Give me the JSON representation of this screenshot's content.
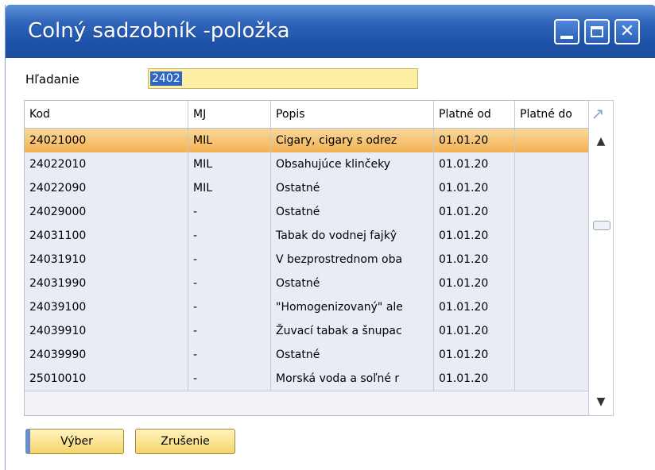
{
  "window": {
    "title": "Colný sadzobník -položka",
    "controls": [
      "minimize-icon",
      "maximize-icon",
      "close-icon"
    ]
  },
  "search": {
    "label": "Hľadanie",
    "value": "2402"
  },
  "table": {
    "columns": [
      "Kod",
      "MJ",
      "Popis",
      "Platné od",
      "Platné do"
    ],
    "rows": [
      {
        "kod": "24021000",
        "mj": "MIL",
        "popis": "Cigary, cigary s odrez",
        "od": "01.01.20",
        "do": "",
        "selected": true
      },
      {
        "kod": "24022010",
        "mj": "MIL",
        "popis": "Obsahujúce klinčeky",
        "od": "01.01.20",
        "do": ""
      },
      {
        "kod": "24022090",
        "mj": "MIL",
        "popis": "Ostatné",
        "od": "01.01.20",
        "do": ""
      },
      {
        "kod": "24029000",
        "mj": "-",
        "popis": "Ostatné",
        "od": "01.01.20",
        "do": ""
      },
      {
        "kod": "24031100",
        "mj": "-",
        "popis": "Tabak do vodnej fajkŷ",
        "od": "01.01.20",
        "do": ""
      },
      {
        "kod": "24031910",
        "mj": "-",
        "popis": "V bezprostrednom oba",
        "od": "01.01.20",
        "do": ""
      },
      {
        "kod": "24031990",
        "mj": "-",
        "popis": "Ostatné",
        "od": "01.01.20",
        "do": ""
      },
      {
        "kod": "24039100",
        "mj": "-",
        "popis": "\"Homogenizovaný\" ale",
        "od": "01.01.20",
        "do": ""
      },
      {
        "kod": "24039910",
        "mj": "-",
        "popis": "Žuvací tabak a šnupac",
        "od": "01.01.20",
        "do": ""
      },
      {
        "kod": "24039990",
        "mj": "-",
        "popis": "Ostatné",
        "od": "01.01.20",
        "do": ""
      },
      {
        "kod": "25010010",
        "mj": "-",
        "popis": "Morská voda a soľné r",
        "od": "01.01.20",
        "do": ""
      }
    ]
  },
  "buttons": {
    "select": "Výber",
    "cancel": "Zrušenie"
  },
  "colors": {
    "titlebar": "#2d63b9",
    "selected_row": "#f3b253",
    "input_bg": "#fdf0a4",
    "row_bg": "#e7ecf5"
  }
}
